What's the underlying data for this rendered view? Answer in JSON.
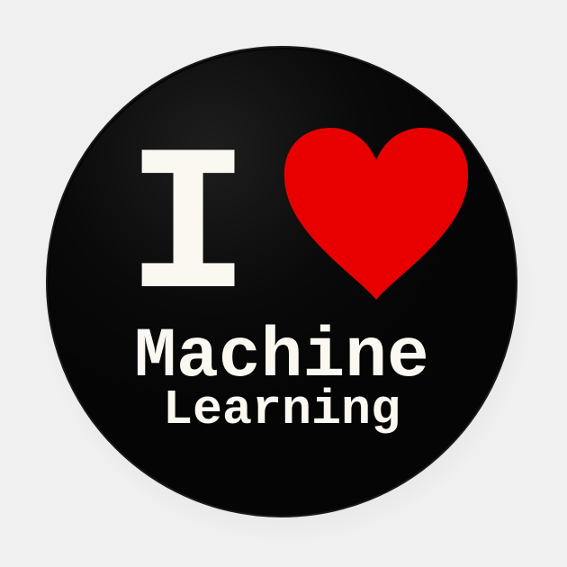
{
  "pin": {
    "word_i": "I",
    "heart_icon": "heart-icon",
    "line1": "Machine",
    "line2": "Learning"
  },
  "colors": {
    "background": "#f0f0f0",
    "button_face": "#050505",
    "text": "#fbf8f1",
    "heart": "#e80000"
  }
}
